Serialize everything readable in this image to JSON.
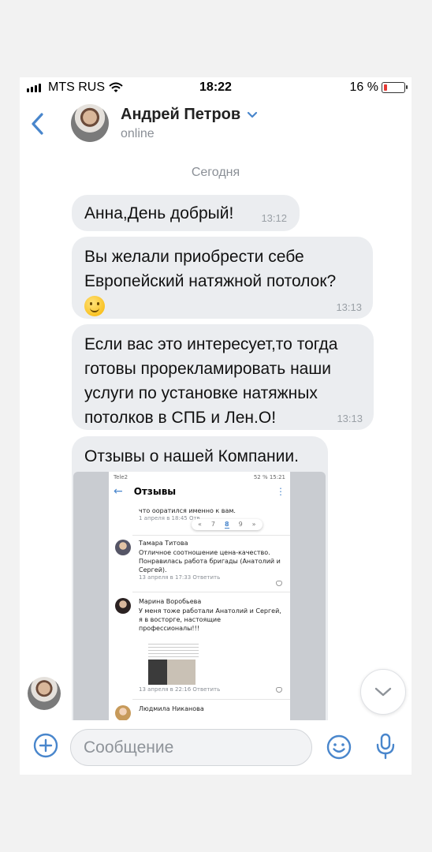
{
  "status_bar": {
    "carrier": "MTS RUS",
    "time": "18:22",
    "battery": "16 %",
    "battery_level": 0.16
  },
  "header": {
    "name": "Андрей Петров",
    "status": "online"
  },
  "chat": {
    "date": "Сегодня",
    "messages": [
      {
        "text": "Анна,День добрый!",
        "time": "13:12"
      },
      {
        "text": "Вы желали приобрести себе Европейский натяжной потолок?",
        "time": "13:13"
      },
      {
        "text": "Если вас это интересует,то тогда готовы прорекламировать наши услуги по установке натяжных потолков в СПБ и Лен.О!",
        "time": "13:13"
      },
      {
        "text": "Отзывы о нашей Компании.",
        "time": ""
      }
    ]
  },
  "screenshot": {
    "status_left": "Tele2",
    "status_right": "52 %  15:21",
    "title": "Отзывы",
    "snippet": "что ооратился именно к вам.",
    "snippet_meta": "1 апреля в 18:45  Отв",
    "pager": [
      "«",
      "7",
      "8",
      "9",
      "»"
    ],
    "reviews": [
      {
        "name": "Тамара Титова",
        "text": "Отличное соотношение цена-качество. Понравилась работа бригады (Анатолий и Сергей).",
        "meta": "13 апреля в 17:33   Ответить"
      },
      {
        "name": "Марина Воробьева",
        "text": "У меня тоже работали Анатолий и Сергей, я в восторге, настоящие профессионалы!!!",
        "meta": "13 апреля в 22:16   Ответить"
      },
      {
        "name": "Людмила Никанова",
        "text": "",
        "meta": ""
      }
    ]
  },
  "composer": {
    "placeholder": "Сообщение"
  },
  "icons": [
    "back-chevron-icon",
    "chevron-down-icon",
    "plus-icon",
    "emoji-icon",
    "microphone-icon",
    "scroll-down-icon"
  ],
  "colors": {
    "accent": "#4986cc",
    "bubble": "#ebedf0",
    "battery_low": "#e53935"
  }
}
